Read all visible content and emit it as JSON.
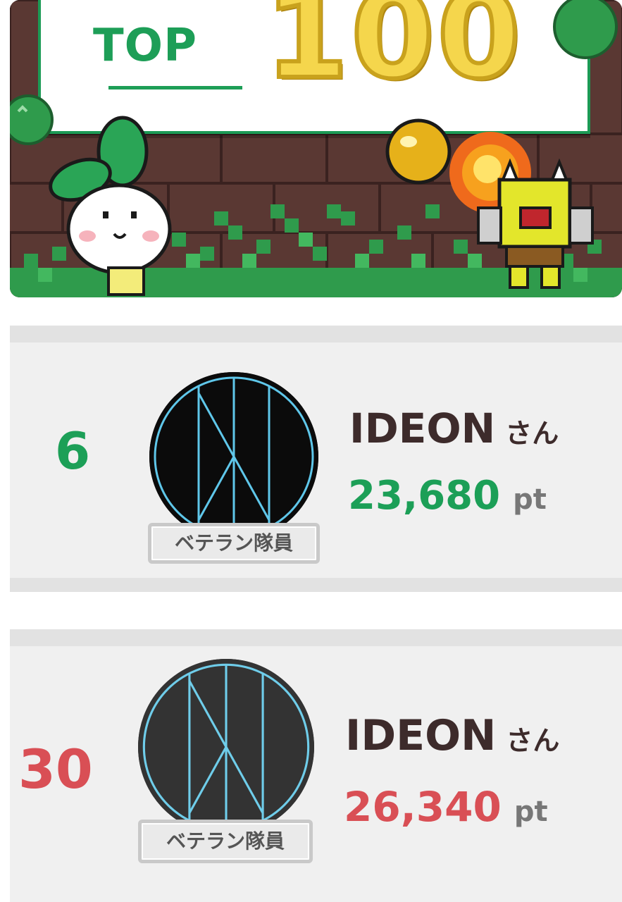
{
  "banner": {
    "top_label": "TOP",
    "number": "100"
  },
  "ranking": [
    {
      "rank": "6",
      "rank_color": "#1c9f57",
      "badge": "ベテラン隊員",
      "name": "IDEON",
      "suffix": "さん",
      "points": "23,680",
      "points_color": "#1c9f57",
      "unit": "pt"
    },
    {
      "rank": "30",
      "rank_color": "#d94f55",
      "badge": "ベテラン隊員",
      "name": "IDEON",
      "suffix": "さん",
      "points": "26,340",
      "points_color": "#d94f55",
      "unit": "pt"
    }
  ],
  "colors": {
    "accent_green": "#1c9f57",
    "accent_red": "#d94f55",
    "gold": "#f5d64c"
  },
  "icons": [
    "rabbit-mascot-icon",
    "ogre-character-icon",
    "fireball-icon",
    "bush-icon",
    "ideon-logo-icon"
  ]
}
